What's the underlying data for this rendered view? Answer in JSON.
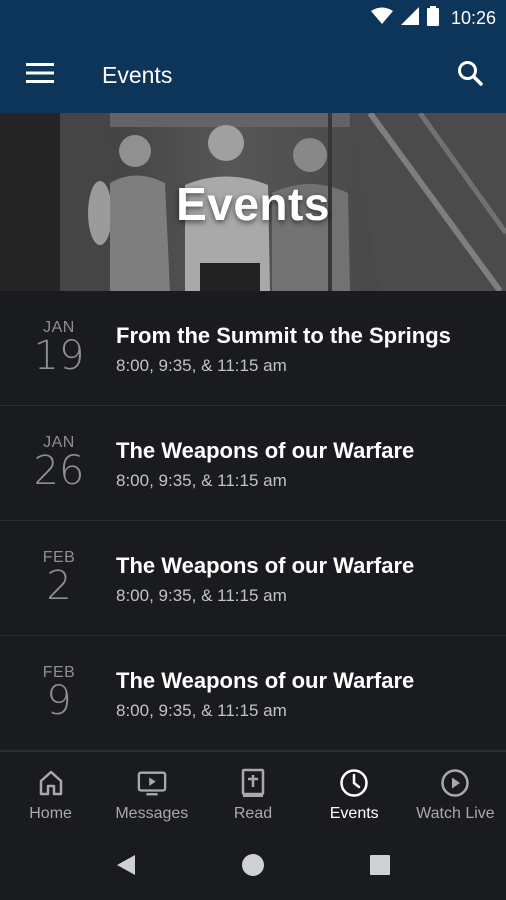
{
  "status_bar": {
    "time": "10:26",
    "icons": [
      "wifi-icon",
      "signal-icon",
      "battery-icon"
    ]
  },
  "app_bar": {
    "title": "Events",
    "menu_icon": "hamburger-menu-icon",
    "search_icon": "search-icon",
    "background": "#0d3459"
  },
  "hero": {
    "title": "Events"
  },
  "events": [
    {
      "month": "JAN",
      "day": "19",
      "title": "From the Summit to the Springs",
      "times": "8:00, 9:35, & 11:15 am"
    },
    {
      "month": "JAN",
      "day": "26",
      "title": "The Weapons of our Warfare",
      "times": "8:00, 9:35, & 11:15 am"
    },
    {
      "month": "FEB",
      "day": "2",
      "title": "The Weapons of our Warfare",
      "times": "8:00, 9:35, & 11:15 am"
    },
    {
      "month": "FEB",
      "day": "9",
      "title": "The Weapons of our Warfare",
      "times": "8:00, 9:35, & 11:15 am"
    }
  ],
  "bottom_nav": {
    "items": [
      {
        "label": "Home",
        "icon": "home-icon",
        "active": false
      },
      {
        "label": "Messages",
        "icon": "tv-play-icon",
        "active": false
      },
      {
        "label": "Read",
        "icon": "bible-icon",
        "active": false
      },
      {
        "label": "Events",
        "icon": "clock-icon",
        "active": true
      },
      {
        "label": "Watch Live",
        "icon": "play-circle-icon",
        "active": false
      }
    ]
  },
  "system_nav": {
    "icons": [
      "back-icon",
      "home-circle-icon",
      "recents-icon"
    ]
  },
  "colors": {
    "app_bar": "#0d3459",
    "list_background": "#1a1b1e",
    "divider": "#2c2d31",
    "muted_text": "#8e8f93"
  }
}
